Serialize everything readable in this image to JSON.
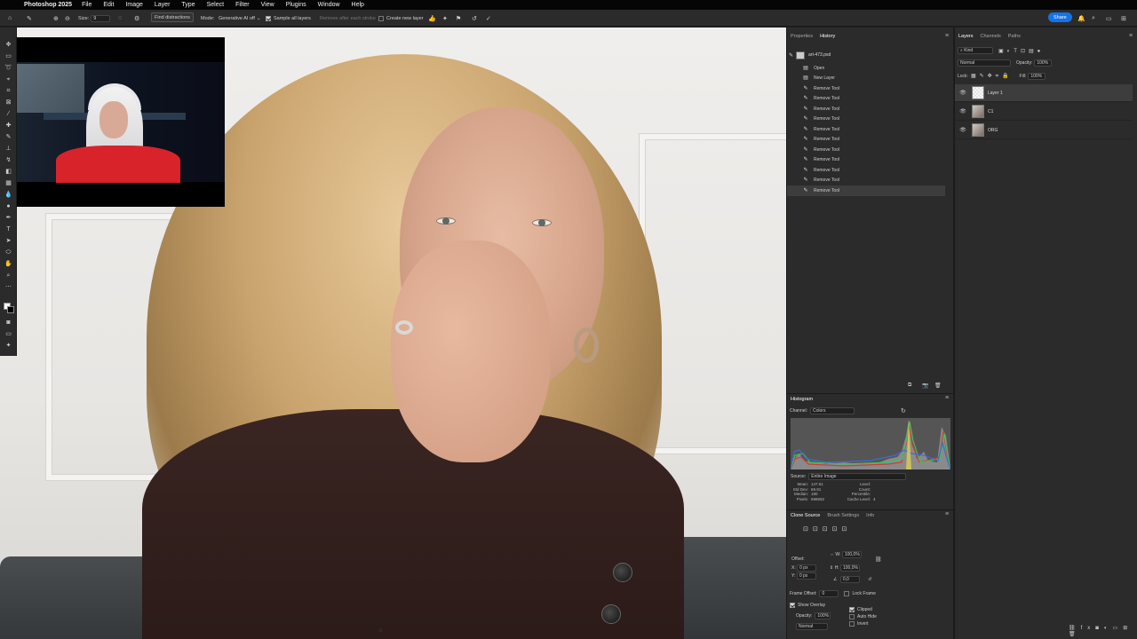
{
  "menubar": {
    "app": "Photoshop 2025",
    "items": [
      "File",
      "Edit",
      "Image",
      "Layer",
      "Type",
      "Select",
      "Filter",
      "View",
      "Plugins",
      "Window",
      "Help"
    ]
  },
  "options": {
    "size_label": "Size:",
    "size_value": "9",
    "find_distractions": "Find distractions",
    "mode_label": "Mode:",
    "mode_value": "Generative AI off",
    "sample_all_layers": "Sample all layers",
    "remove_after_stroke": "Remove after each stroke",
    "create_new_layer": "Create new layer",
    "share": "Share"
  },
  "history_panel": {
    "tabs": [
      "Properties",
      "History"
    ],
    "doc_name": "art-473.psd",
    "items": [
      "Open",
      "New Layer",
      "Remove Tool",
      "Remove Tool",
      "Remove Tool",
      "Remove Tool",
      "Remove Tool",
      "Remove Tool",
      "Remove Tool",
      "Remove Tool",
      "Remove Tool",
      "Remove Tool",
      "Remove Tool"
    ]
  },
  "layers_panel": {
    "tabs": [
      "Layers",
      "Channels",
      "Paths"
    ],
    "kind_label": "Kind",
    "blend_mode": "Normal",
    "opacity_label": "Opacity:",
    "opacity_value": "100%",
    "lock_label": "Lock:",
    "fill_label": "Fill:",
    "fill_value": "100%",
    "layers": [
      {
        "name": "Layer 1",
        "selected": true
      },
      {
        "name": "C1",
        "selected": false
      },
      {
        "name": "ORG",
        "selected": false
      }
    ]
  },
  "histogram": {
    "title": "Histogram",
    "channel_label": "Channel:",
    "channel_value": "Colors",
    "source_label": "Source:",
    "source_value": "Entire Image",
    "stats_left": [
      "Mean:",
      "Std Dev:",
      "Median:",
      "Pixels:"
    ],
    "stats_left_values": [
      "147.61",
      "69.91",
      "180",
      "698592"
    ],
    "stats_right": [
      "Level:",
      "Count:",
      "Percentile:",
      "Cache Level:"
    ],
    "stats_right_values": [
      "",
      "",
      "",
      "4"
    ]
  },
  "clone_source": {
    "tabs": [
      "Clone Source",
      "Brush Settings",
      "Info"
    ],
    "offset_label": "Offset:",
    "x_label": "X:",
    "x_value": "0 px",
    "y_label": "Y:",
    "y_value": "0 px",
    "w_label": "W:",
    "w_value": "100,0%",
    "h_label": "H:",
    "h_value": "100,0%",
    "angle_value": "0,0",
    "frame_offset_label": "Frame Offset:",
    "frame_offset_value": "0",
    "lock_frame": "Lock Frame",
    "show_overlay": "Show Overlay",
    "opacity_label": "Opacity:",
    "opacity_value": "100%",
    "blend_value": "Normal",
    "clipped": "Clipped",
    "auto_hide": "Auto Hide",
    "invert": "Invert"
  }
}
